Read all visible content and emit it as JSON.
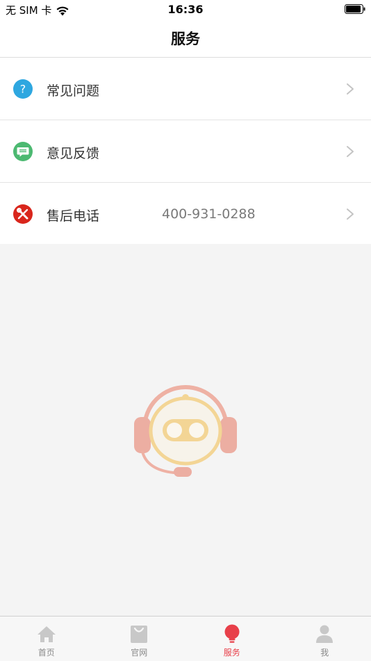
{
  "status_bar": {
    "carrier": "无 SIM 卡",
    "time": "16:36"
  },
  "nav": {
    "title": "服务"
  },
  "menu": [
    {
      "label": "常见问题",
      "value": "",
      "icon": "question-icon",
      "color": "#2ea7e0"
    },
    {
      "label": "意见反馈",
      "value": "",
      "icon": "chat-bubble-icon",
      "color": "#4cb971"
    },
    {
      "label": "售后电话",
      "value": "400-931-0288",
      "icon": "wrench-screwdriver-icon",
      "color": "#d9261c"
    }
  ],
  "tabs": [
    {
      "label": "首页",
      "icon": "home-icon",
      "active": false
    },
    {
      "label": "官网",
      "icon": "shopping-bag-icon",
      "active": false
    },
    {
      "label": "服务",
      "icon": "lightbulb-icon",
      "active": true
    },
    {
      "label": "我",
      "icon": "person-icon",
      "active": false
    }
  ],
  "colors": {
    "accent": "#e8404a",
    "tab_inactive": "#c8c8c8"
  }
}
